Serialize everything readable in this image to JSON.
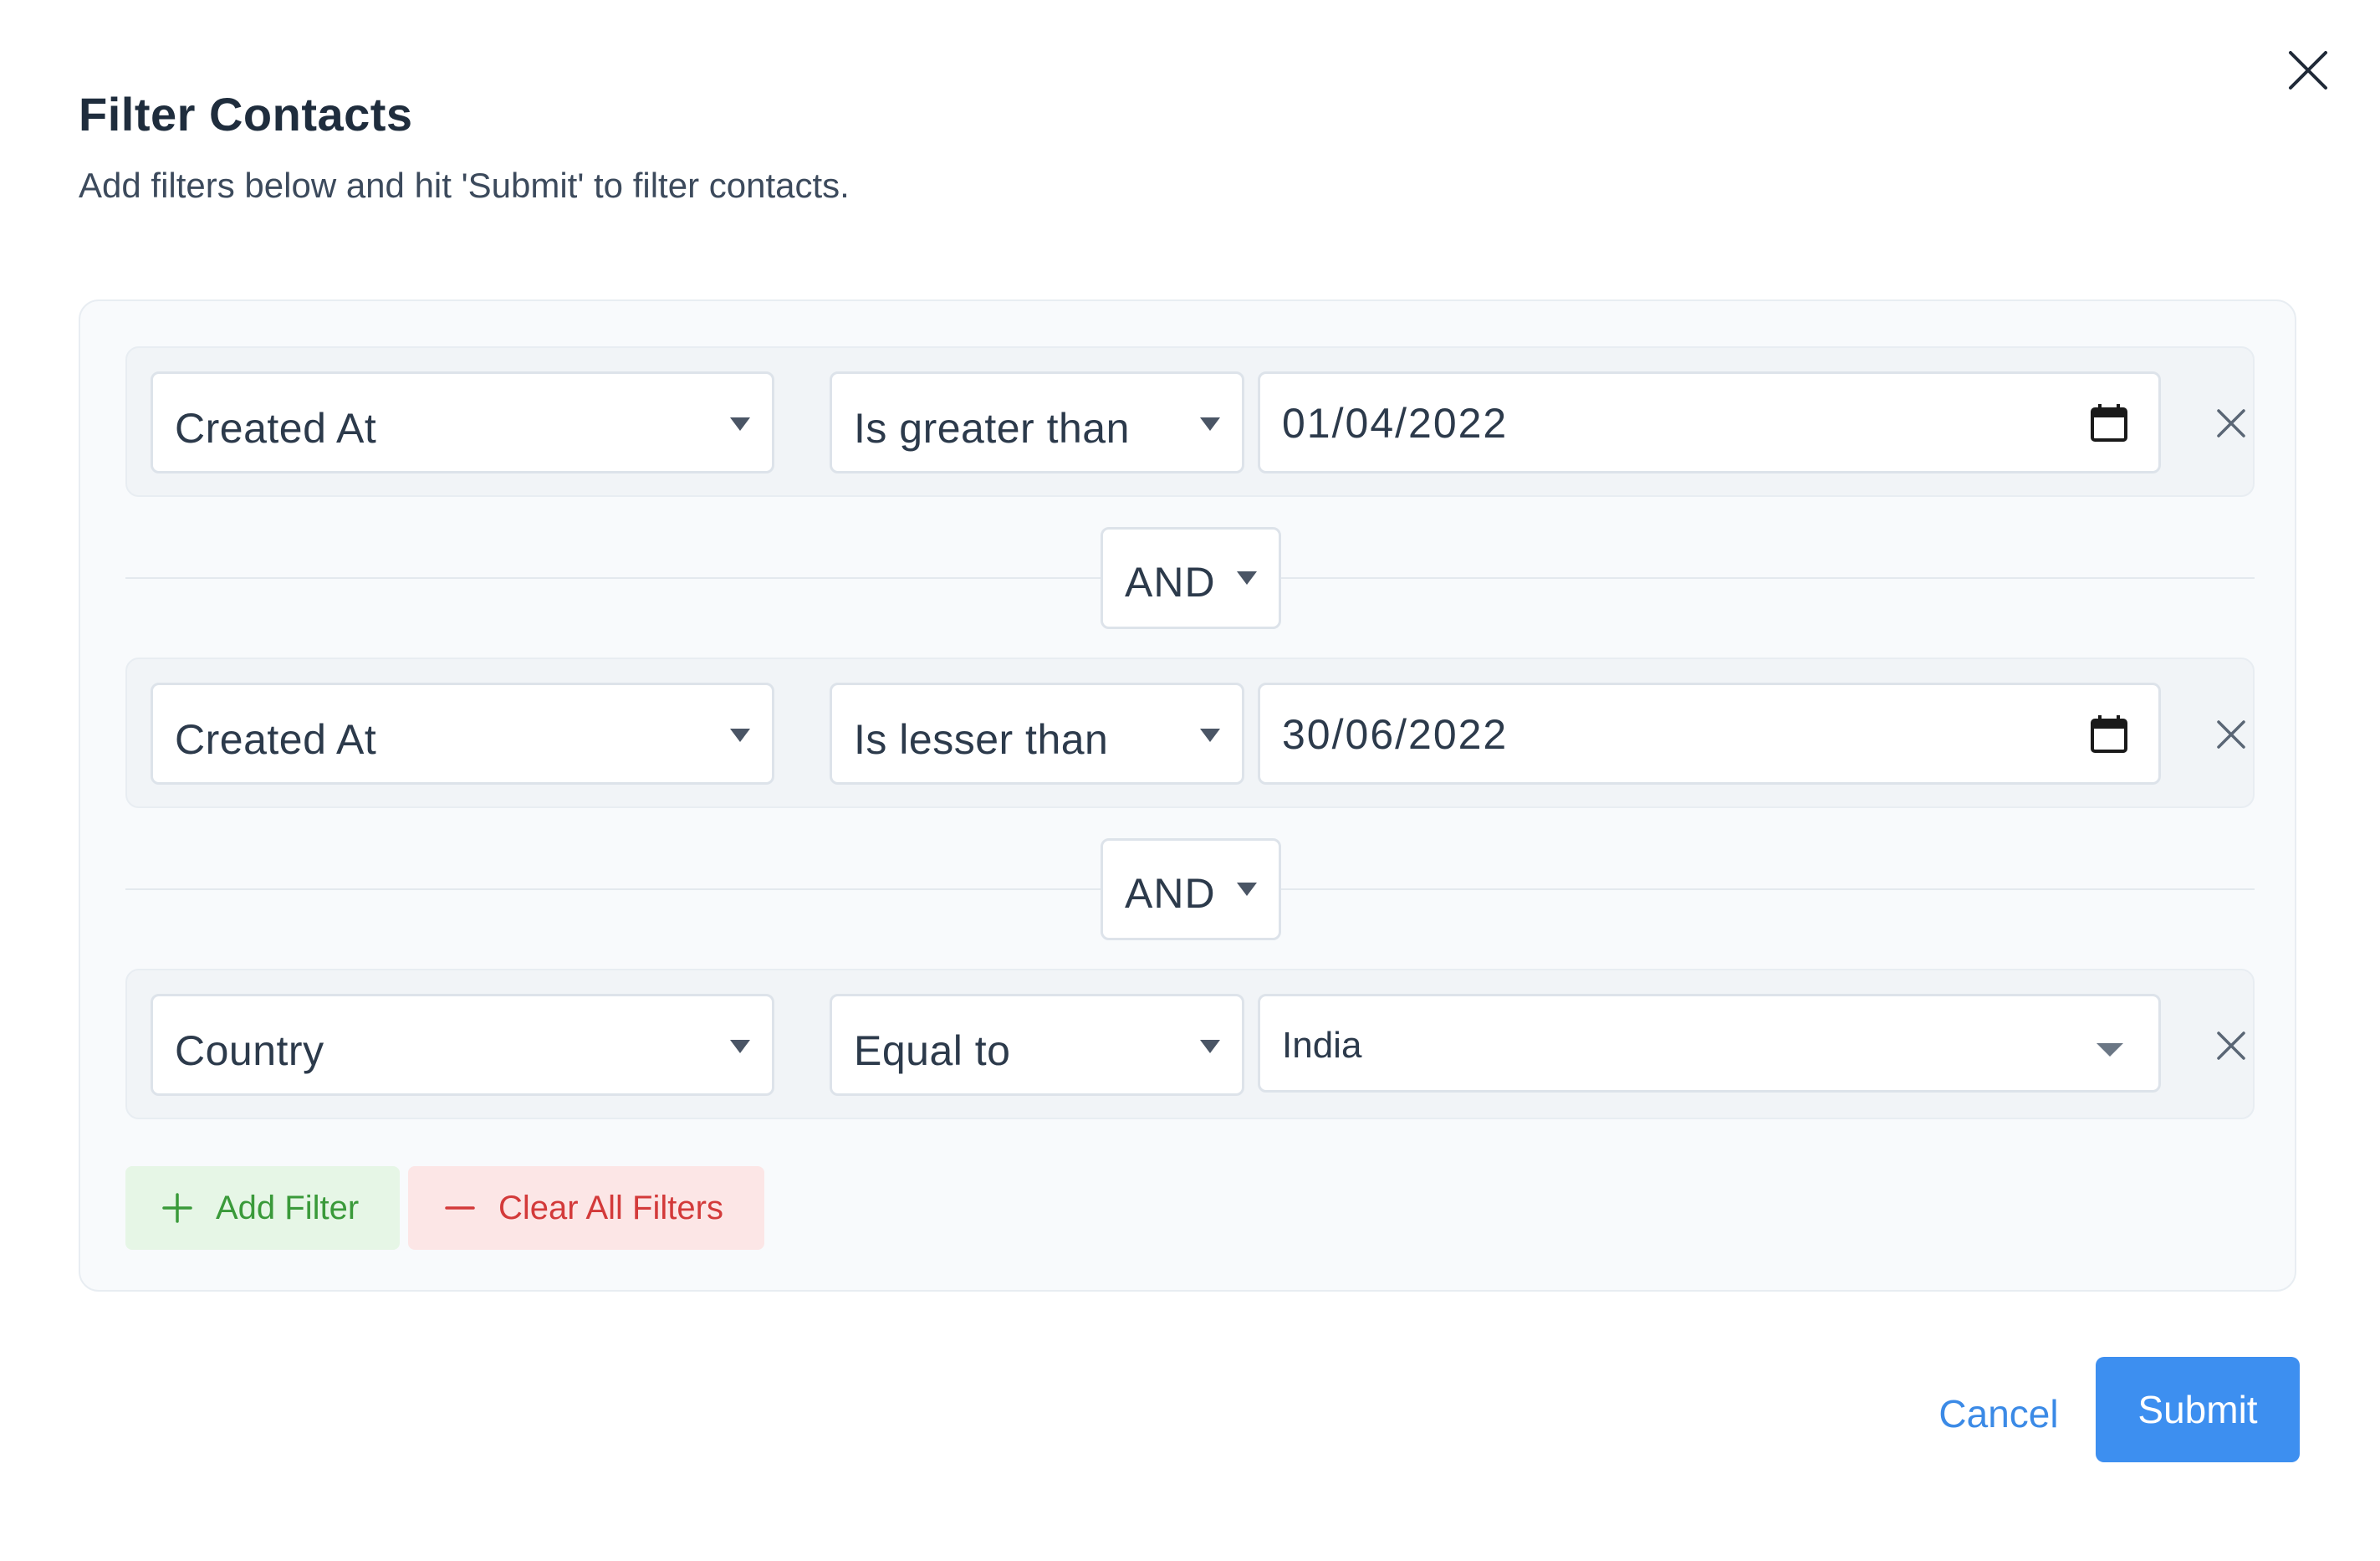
{
  "modal": {
    "title": "Filter Contacts",
    "subtitle": "Add filters below and hit 'Submit' to filter contacts.",
    "close_icon": "close-icon"
  },
  "filters": [
    {
      "attribute": "Created At",
      "operator": "Is greater than",
      "value": "01/04/2022",
      "value_type": "date"
    },
    {
      "attribute": "Created At",
      "operator": "Is lesser than",
      "value": "30/06/2022",
      "value_type": "date"
    },
    {
      "attribute": "Country",
      "operator": "Equal to",
      "value": "India",
      "value_type": "select"
    }
  ],
  "connectors": [
    {
      "label": "AND"
    },
    {
      "label": "AND"
    }
  ],
  "actions": {
    "add_filter": "Add Filter",
    "clear_all": "Clear All Filters"
  },
  "footer": {
    "cancel": "Cancel",
    "submit": "Submit"
  },
  "colors": {
    "accent": "#3d8ff0",
    "add_green": "#3a9a3a",
    "clear_red": "#d33a3a"
  }
}
